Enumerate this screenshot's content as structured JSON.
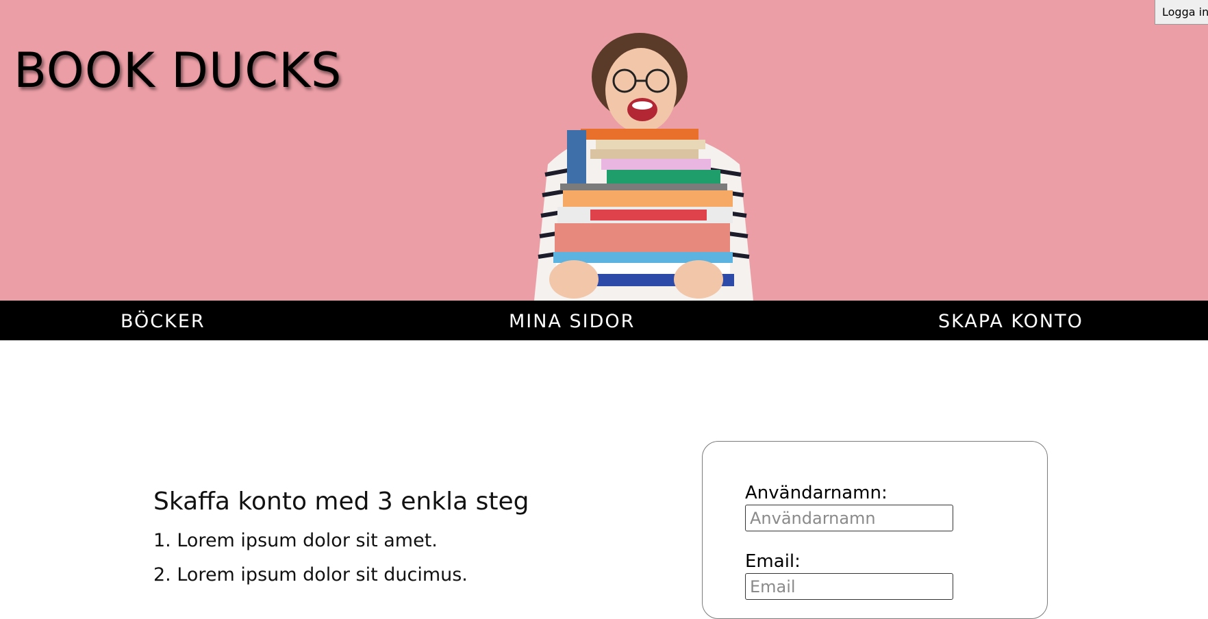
{
  "header": {
    "brand": "BOOK DUCKS",
    "login_label": "Logga in",
    "background_color": "#ec9ea6"
  },
  "nav": {
    "items": [
      {
        "label": "BÖCKER"
      },
      {
        "label": "MINA SIDOR"
      },
      {
        "label": "SKAPA KONTO"
      }
    ]
  },
  "main": {
    "title": "Skaffa konto med 3 enkla steg",
    "steps": [
      "1. Lorem ipsum dolor sit amet.",
      "2. Lorem ipsum dolor sit ducimus."
    ]
  },
  "form": {
    "username_label": "Användarnamn:",
    "username_placeholder": "Användarnamn",
    "email_label": "Email:",
    "email_placeholder": "Email"
  }
}
